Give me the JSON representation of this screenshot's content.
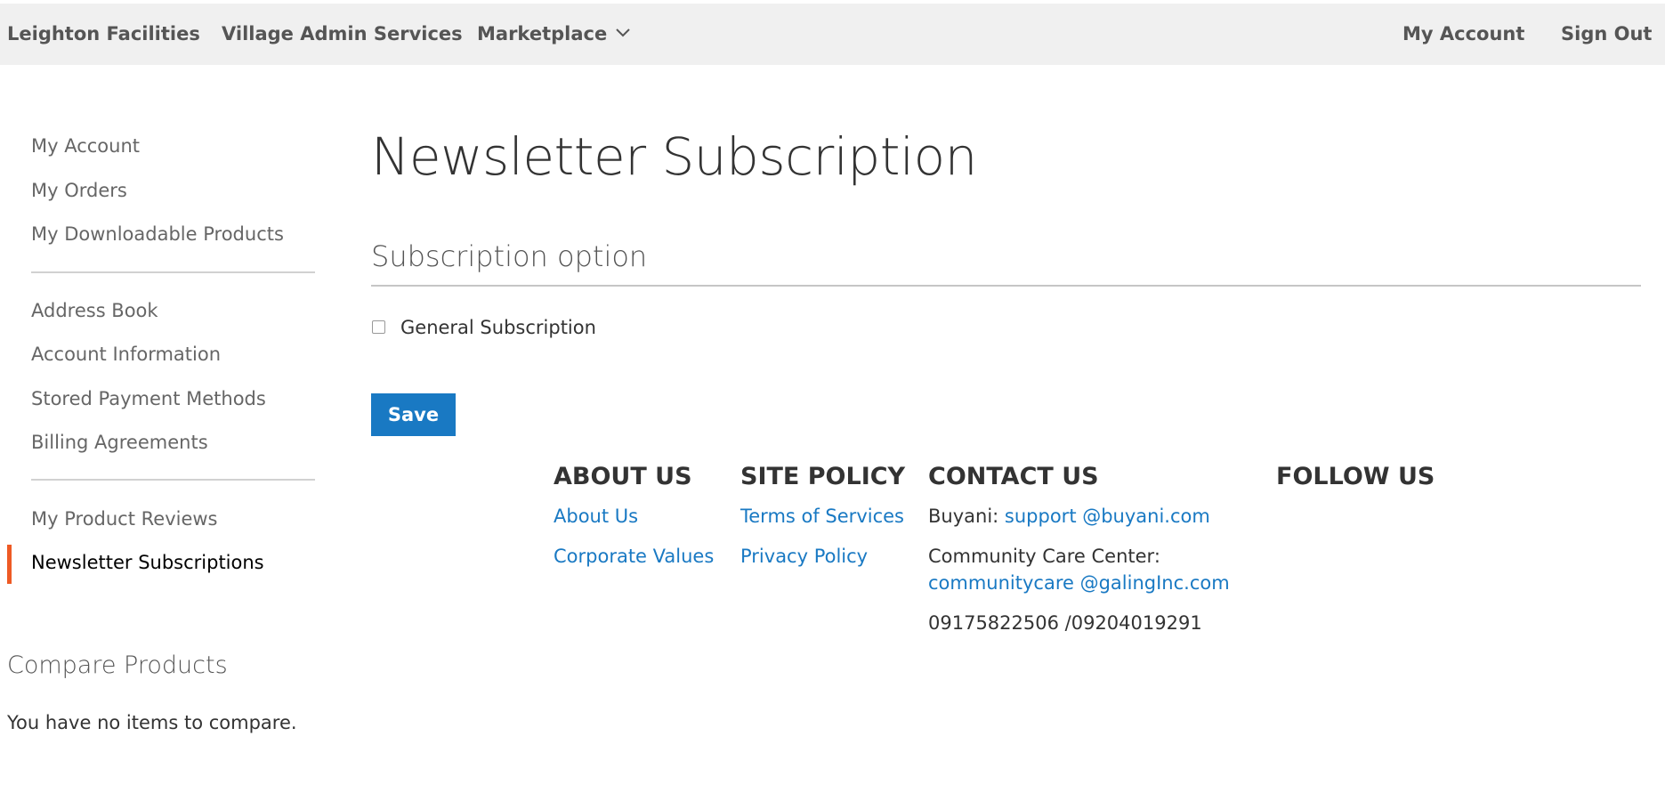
{
  "topnav": {
    "items": [
      {
        "label": "Leighton Facilities"
      },
      {
        "label": "Village Admin Services"
      },
      {
        "label": "Marketplace"
      }
    ],
    "right": [
      {
        "label": "My Account"
      },
      {
        "label": "Sign Out"
      }
    ]
  },
  "sidebar": {
    "groups": [
      [
        "My Account",
        "My Orders",
        "My Downloadable Products"
      ],
      [
        "Address Book",
        "Account Information",
        "Stored Payment Methods",
        "Billing Agreements"
      ],
      [
        "My Product Reviews",
        "Newsletter Subscriptions"
      ]
    ],
    "active": "Newsletter Subscriptions"
  },
  "compare": {
    "title": "Compare Products",
    "empty_text": "You have no items to compare."
  },
  "main": {
    "title": "Newsletter Subscription",
    "section_title": "Subscription option",
    "checkbox_label": "General Subscription",
    "checkbox_checked": false,
    "save_label": "Save"
  },
  "footer": {
    "about": {
      "heading": "ABOUT US",
      "links": [
        "About Us",
        "Corporate Values"
      ]
    },
    "policy": {
      "heading": "SITE POLICY",
      "links": [
        "Terms of Services",
        "Privacy Policy"
      ]
    },
    "contact": {
      "heading": "CONTACT US",
      "buyani_label": "Buyani:",
      "buyani_email": "support @buyani.com",
      "care_label": "Community Care Center:",
      "care_email": "communitycare @galingInc.com",
      "phones": "09175822506 /09204019291"
    },
    "follow": {
      "heading": "FOLLOW US"
    }
  },
  "colors": {
    "accent": "#1979c3",
    "active_marker": "#ee5a24",
    "topbar_bg": "#f0f0f0"
  }
}
